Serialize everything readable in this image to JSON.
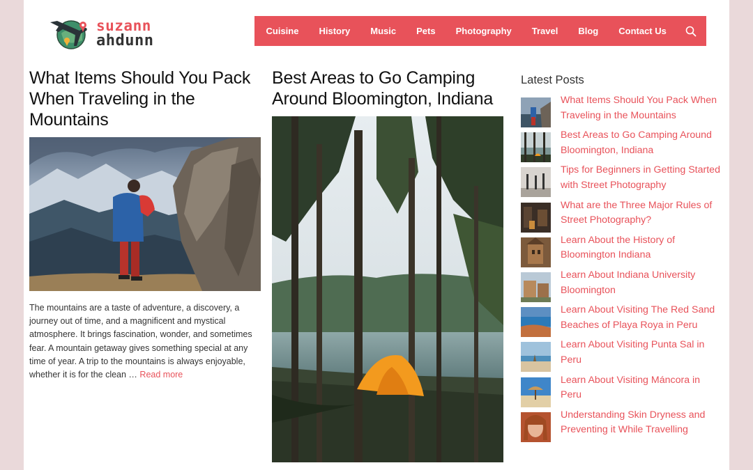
{
  "site": {
    "logo_line1": "suzann",
    "logo_line2": "ahdunn"
  },
  "nav": {
    "items": [
      "Cuisine",
      "History",
      "Music",
      "Pets",
      "Photography",
      "Travel",
      "Blog",
      "Contact Us"
    ],
    "search_icon": "search-icon",
    "color": "#e8525a"
  },
  "posts": [
    {
      "title": "What Items Should You Pack When Traveling in the Mountains",
      "excerpt": "The mountains are a taste of adventure, a discovery, a journey out of time, and a magnificent and mystical atmosphere. It brings fascination, wonder, and sometimes fear. A mountain getaway gives something special at any time of year. A trip to the mountains is always enjoyable, whether it is for the clean …",
      "read_more": "Read more"
    },
    {
      "title": "Best Areas to Go Camping Around Bloomington, Indiana"
    }
  ],
  "sidebar": {
    "title": "Latest Posts",
    "items": [
      "What Items Should You Pack When Traveling in the Mountains",
      "Best Areas to Go Camping Around Bloomington, Indiana",
      "Tips for Beginners in Getting Started with Street Photography",
      "What are the Three Major Rules of Street Photography?",
      "Learn About the History of Bloomington Indiana",
      "Learn About Indiana University Bloomington",
      "Learn About Visiting The Red Sand Beaches of Playa Roya in Peru",
      "Learn About Visiting Punta Sal in Peru",
      "Learn About Visiting Máncora in Peru",
      "Understanding Skin Dryness and Preventing it While Travelling"
    ]
  }
}
